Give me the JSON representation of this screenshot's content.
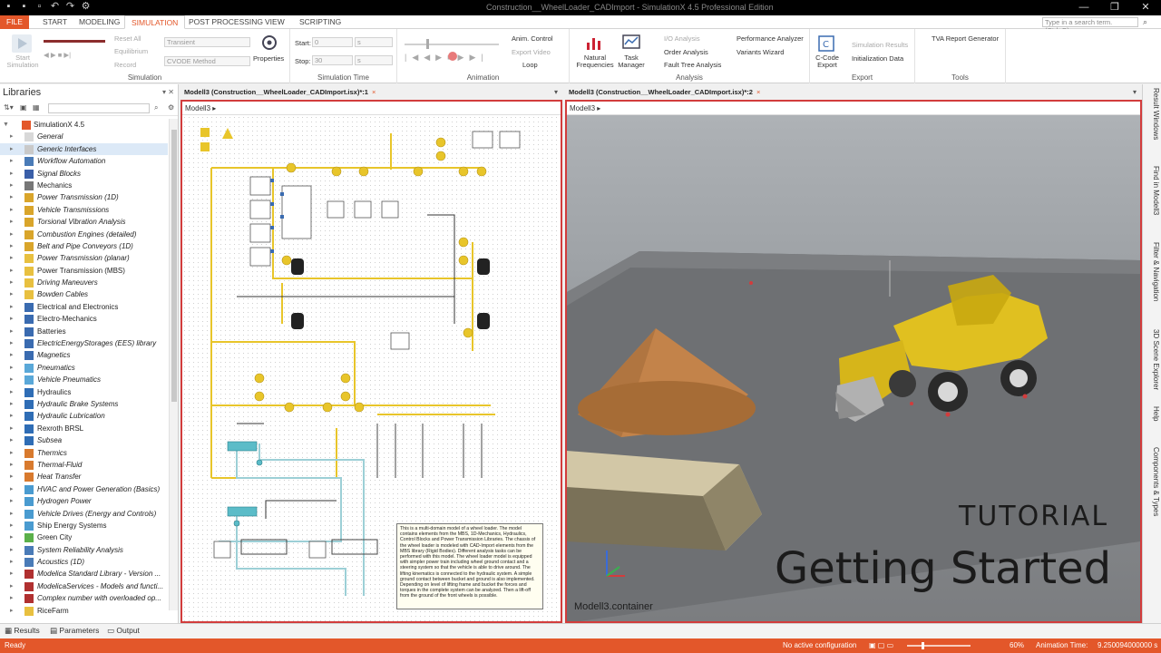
{
  "window": {
    "title": "Construction__WheelLoader_CADImport - SimulationX 4.5 Professional Edition",
    "quick_access": [
      "save-icon",
      "save-all-icon",
      "open-icon",
      "undo-icon",
      "redo-icon",
      "settings-icon"
    ],
    "controls": [
      "—",
      "❐",
      "✕"
    ]
  },
  "ribbon_tabs": [
    "FILE",
    "START",
    "MODELING",
    "SIMULATION",
    "POST PROCESSING",
    "VIEW",
    "SCRIPTING"
  ],
  "active_tab": "SIMULATION",
  "search": {
    "placeholder": "Type in a search term. (Ctrl+Q)"
  },
  "ribbon": {
    "simulation": {
      "label": "Simulation",
      "start": "Start Simulation",
      "reset_all": "Reset All",
      "equilibrium": "Equilibrium",
      "record": "Record",
      "solver_type": "Transient",
      "solver_method": "CVODE Method",
      "properties": "Properties"
    },
    "simulation_time": {
      "label": "Simulation Time",
      "start_label": "Start:",
      "start_value": "0",
      "start_unit": "s",
      "stop_label": "Stop:",
      "stop_value": "30",
      "stop_unit": "s"
    },
    "animation": {
      "label": "Animation",
      "anim_control": "Anim. Control",
      "export_video": "Export Video",
      "loop": "Loop"
    },
    "analysis": {
      "label": "Analysis",
      "natural_freq": "Natural Frequencies",
      "task_manager": "Task Manager",
      "io_analysis": "I/O Analysis",
      "order_analysis": "Order Analysis",
      "fault_tree": "Fault Tree Analysis",
      "performance": "Performance Analyzer",
      "variants": "Variants Wizard"
    },
    "export": {
      "label": "Export",
      "ccode": "C-Code Export",
      "sim_results": "Simulation Results",
      "init_data": "Initialization Data"
    },
    "tools": {
      "label": "Tools",
      "tva": "TVA Report Generator"
    }
  },
  "libraries": {
    "title": "Libraries",
    "root": "SimulationX 4.5",
    "items": [
      {
        "label": "General",
        "color": "#d8d8d8"
      },
      {
        "label": "Generic Interfaces",
        "color": "#c9c9c9"
      },
      {
        "label": "Workflow Automation",
        "color": "#4a7bb7"
      },
      {
        "label": "Signal Blocks",
        "color": "#3a5fa8"
      },
      {
        "label": "Mechanics",
        "color": "#777777"
      },
      {
        "label": "Power Transmission (1D)",
        "color": "#d9a52b"
      },
      {
        "label": "Vehicle Transmissions",
        "color": "#d9a52b"
      },
      {
        "label": "Torsional Vibration Analysis",
        "color": "#d9a52b"
      },
      {
        "label": "Combustion Engines (detailed)",
        "color": "#d9a52b"
      },
      {
        "label": "Belt and Pipe Conveyors (1D)",
        "color": "#d9a52b"
      },
      {
        "label": "Power Transmission (planar)",
        "color": "#e8c040"
      },
      {
        "label": "Power Transmission (MBS)",
        "color": "#e8c040"
      },
      {
        "label": "Driving Maneuvers",
        "color": "#e8c040"
      },
      {
        "label": "Bowden Cables",
        "color": "#e8c040"
      },
      {
        "label": "Electrical and Electronics",
        "color": "#3a6bb0"
      },
      {
        "label": "Electro-Mechanics",
        "color": "#3a6bb0"
      },
      {
        "label": "Batteries",
        "color": "#3a6bb0"
      },
      {
        "label": "ElectricEnergyStorages (EES) library",
        "color": "#3a6bb0"
      },
      {
        "label": "Magnetics",
        "color": "#3a6bb0"
      },
      {
        "label": "Pneumatics",
        "color": "#5aa8d8"
      },
      {
        "label": "Vehicle Pneumatics",
        "color": "#5aa8d8"
      },
      {
        "label": "Hydraulics",
        "color": "#2f6db5"
      },
      {
        "label": "Hydraulic Brake Systems",
        "color": "#2f6db5"
      },
      {
        "label": "Hydraulic Lubrication",
        "color": "#2f6db5"
      },
      {
        "label": "Rexroth BRSL",
        "color": "#2f6db5"
      },
      {
        "label": "Subsea",
        "color": "#2f6db5"
      },
      {
        "label": "Thermics",
        "color": "#d87a2e"
      },
      {
        "label": "Thermal-Fluid",
        "color": "#d87a2e"
      },
      {
        "label": "Heat Transfer",
        "color": "#d87a2e"
      },
      {
        "label": "HVAC and Power Generation (Basics)",
        "color": "#4a9bd0"
      },
      {
        "label": "Hydrogen Power",
        "color": "#4a9bd0"
      },
      {
        "label": "Vehicle Drives (Energy and Controls)",
        "color": "#4a9bd0"
      },
      {
        "label": "Ship Energy Systems",
        "color": "#4a9bd0"
      },
      {
        "label": "Green City",
        "color": "#5bb04a"
      },
      {
        "label": "System Reliability Analysis",
        "color": "#4a7bb7"
      },
      {
        "label": "Acoustics (1D)",
        "color": "#4a7bb7"
      },
      {
        "label": "Modelica Standard Library - Version ...",
        "color": "#b03030"
      },
      {
        "label": "ModelicaServices - Models and functi...",
        "color": "#b03030"
      },
      {
        "label": "Complex number with overloaded op...",
        "color": "#b03030"
      },
      {
        "label": "RiceFarm",
        "color": "#e8c040"
      }
    ]
  },
  "bottom_tabs": [
    "Results",
    "Parameters",
    "Output"
  ],
  "status": {
    "ready": "Ready",
    "config": "No active configuration",
    "zoom": "60%",
    "anim_time_label": "Animation Time:",
    "anim_time": "9.250094000000 s"
  },
  "doc_left": {
    "tab": "Modell3 (Construction__WheelLoader_CADImport.isx)*:1",
    "crumb": "Modell3",
    "note": "This is a multi-domain model of a wheel loader. The model contains elements from the MBS, 1D-Mechanics, Hydraulics, Control Blocks and Power Transmission Libraries. The chassis of the wheel loader is modeled with CAD-Import elements from the MBS library (Rigid Bodies). Different analysis tasks can be performed with this model. The wheel loader model is equipped with simpler power train including wheel ground contact and a steering system so that the vehicle is able to drive around. The lifting kinematics is connected to the hydraulic system. A simple ground contact between bucket and ground is also implemented. Depending on level of lifting frame and bucket the forces and torques in the complete system can be analyzed. Then a lift-off from the ground of the front wheels is possible."
  },
  "doc_right": {
    "tab": "Modell3 (Construction__WheelLoader_CADImport.isx)*:2",
    "crumb": "Modell3",
    "container": "Modell3.container",
    "tutorial": "TUTORIAL",
    "headline": "Getting Started"
  },
  "right_sidebar": [
    "Result Windows",
    "Find in Modell3",
    "Filter & Navigation",
    "3D Scene Explorer",
    "Help",
    "Components & Types"
  ],
  "colors": {
    "accent": "#e3572a",
    "frame": "#d23c3c",
    "yellow": "#e8c52a"
  }
}
